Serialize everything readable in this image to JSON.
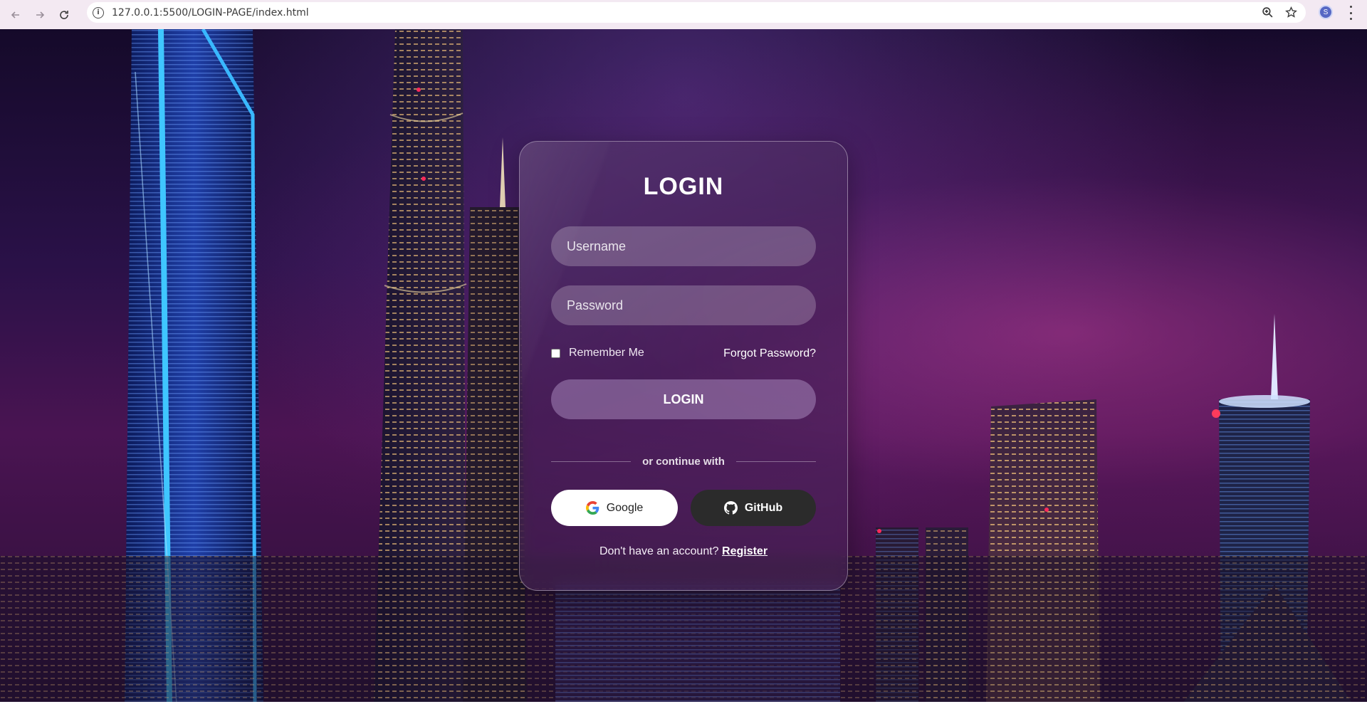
{
  "browser": {
    "url": "127.0.0.1:5500/LOGIN-PAGE/index.html",
    "avatar_letter": "S",
    "icons": {
      "back": "arrow-left-icon",
      "forward": "arrow-right-icon",
      "reload": "reload-icon",
      "site_info": "info-icon",
      "zoom": "zoom-icon",
      "bookmark": "star-icon",
      "menu": "kebab-menu-icon"
    }
  },
  "login": {
    "title": "LOGIN",
    "username_placeholder": "Username",
    "password_placeholder": "Password",
    "remember_label": "Remember Me",
    "forgot_label": "Forgot Password?",
    "submit_label": "LOGIN",
    "divider_text": "or continue with",
    "google_label": "Google",
    "github_label": "GitHub",
    "register_prompt": "Don't have an account?",
    "register_link": "Register"
  },
  "colors": {
    "chrome_bg": "#f3e9f2",
    "card_border": "rgba(255,255,255,0.38)",
    "github_bg": "#2b2b2b",
    "google_bg": "#ffffff"
  }
}
